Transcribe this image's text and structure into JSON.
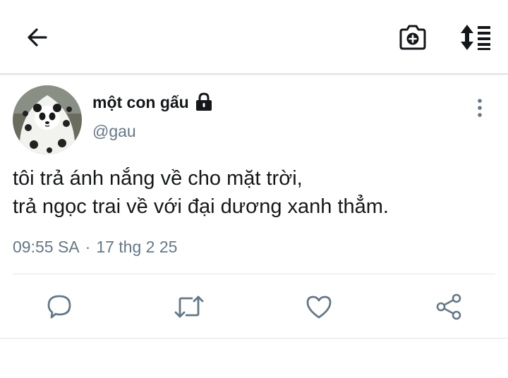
{
  "topbar": {
    "back_icon": "arrow-left-icon",
    "camera_icon": "camera-plus-icon",
    "sort_icon": "sort-list-icon"
  },
  "tweet": {
    "author": {
      "display_name": "một con gấu",
      "handle": "@gau",
      "protected_icon": "lock-icon",
      "avatar": "panda-avatar"
    },
    "text_lines": [
      "tôi trả ánh nắng về cho mặt trời,",
      "trả ngọc trai về với đại dương xanh thẳm."
    ],
    "time": "09:55 SA",
    "separator": "·",
    "date": "17 thg 2 25",
    "more_icon": "more-vertical-icon"
  },
  "actions": {
    "reply_icon": "reply-icon",
    "retweet_icon": "retweet-icon",
    "like_icon": "heart-icon",
    "share_icon": "share-icon"
  },
  "colors": {
    "text": "#14171a",
    "secondary": "#657786",
    "icon": "#1da1f2",
    "action_icon": "#657786"
  }
}
